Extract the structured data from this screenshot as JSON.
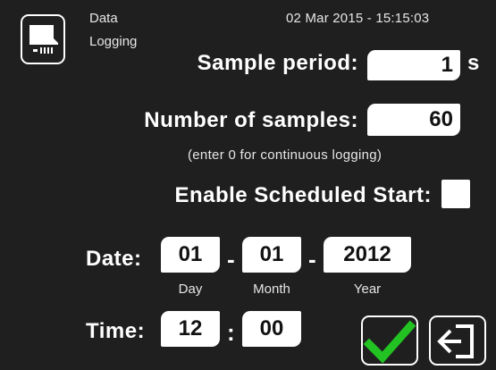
{
  "header": {
    "screen_title_line1": "Data",
    "screen_title_line2": "Logging",
    "timestamp": "02 Mar 2015 - 15:15:03",
    "icon": "sd-card-icon"
  },
  "sample_period": {
    "label": "Sample period:",
    "value": "1",
    "unit": "s"
  },
  "num_samples": {
    "label": "Number of samples:",
    "value": "60",
    "hint": "(enter 0 for continuous logging)"
  },
  "scheduled_start": {
    "label": "Enable Scheduled Start:",
    "checked": false
  },
  "date": {
    "label": "Date:",
    "day": "01",
    "month": "01",
    "year": "2012",
    "separator": "-",
    "day_label": "Day",
    "month_label": "Month",
    "year_label": "Year"
  },
  "time": {
    "label": "Time:",
    "hour": "12",
    "minute": "00",
    "separator": ":"
  },
  "buttons": {
    "confirm_icon": "checkmark-icon",
    "exit_icon": "exit-icon"
  },
  "colors": {
    "background": "#1f1f1f",
    "foreground": "#ffffff",
    "confirm_green": "#22c222"
  }
}
